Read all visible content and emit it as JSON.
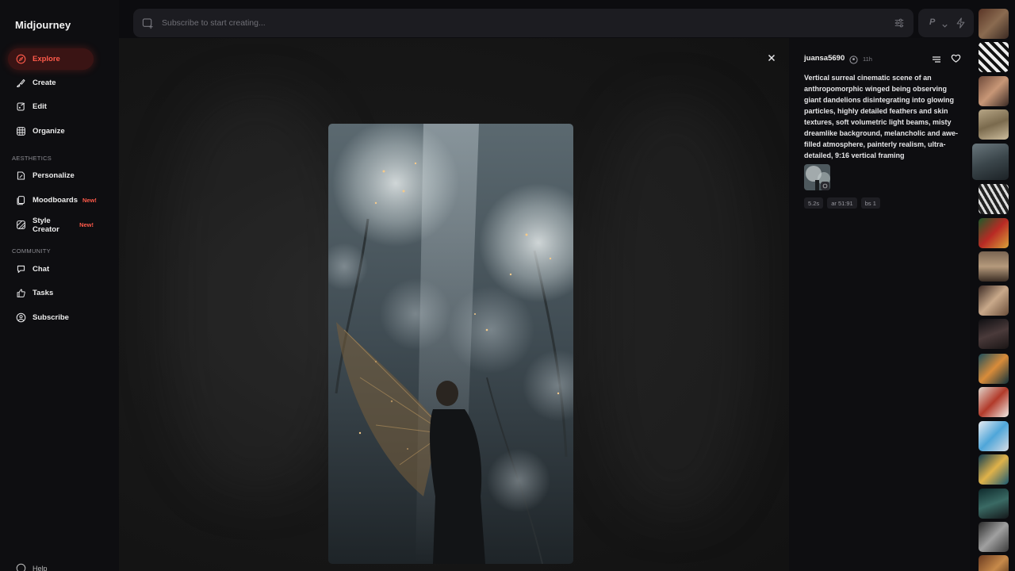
{
  "sidebar": {
    "logo": "Midjourney",
    "items": [
      {
        "label": "Explore"
      },
      {
        "label": "Create"
      },
      {
        "label": "Edit"
      },
      {
        "label": "Organize"
      }
    ],
    "aesthetics_label": "AESTHETICS",
    "aesthetics_items": [
      {
        "label": "Personalize",
        "badge": ""
      },
      {
        "label": "Moodboards",
        "badge": "New!"
      },
      {
        "label": "Style Creator",
        "badge": "New!"
      }
    ],
    "community_label": "COMMUNITY",
    "community_items": [
      {
        "label": "Chat"
      },
      {
        "label": "Tasks"
      },
      {
        "label": "Subscribe"
      }
    ],
    "help_label": "Help"
  },
  "search": {
    "placeholder": "Subscribe to start creating..."
  },
  "mode": {
    "letter": "P"
  },
  "detail": {
    "author": "juansa5690",
    "time_ago": "11h",
    "prompt": "Vertical surreal cinematic scene of an anthropomorphic winged being observing giant dandelions disintegrating into glowing particles, highly detailed feathers and skin textures, soft volumetric light beams, misty dreamlike background, melancholic and awe-filled atmosphere, painterly realism, ultra-detailed, 9:16 vertical framing",
    "params": [
      "5.2s",
      "ar 51:91",
      "bs 1"
    ]
  },
  "colors": {
    "accent": "#ff5a4a",
    "background": "#0c0c0f",
    "panel": "#0e0e11"
  }
}
